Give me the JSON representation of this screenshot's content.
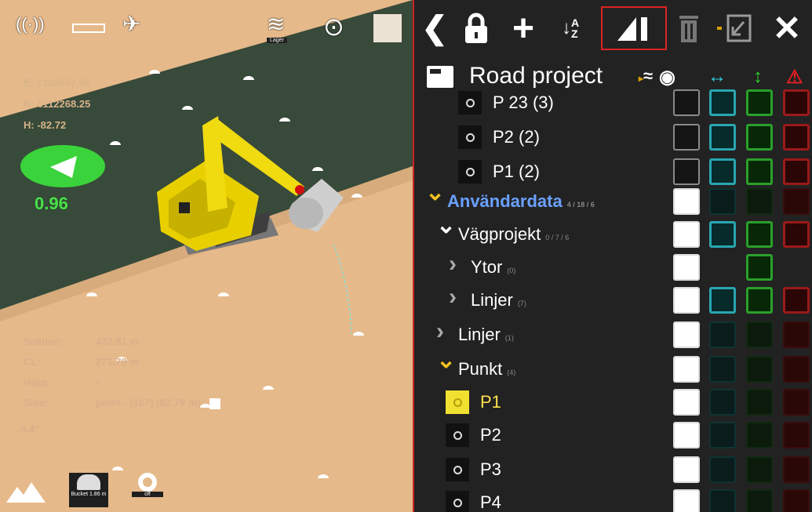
{
  "view": {
    "hud_top": {
      "signal_icon": "radio-signal-icon",
      "battery_icon": "battery-icon",
      "satellite_icon": "satellite-icon",
      "layers_icon": "layers-icon",
      "layers_label": "Lager",
      "locate_icon": "crosshair-icon",
      "cube_icon": "cube-icon"
    },
    "coords": {
      "e": "E: 1336957.66",
      "n": "N: 6112268.25",
      "h": "H: -82.72"
    },
    "speed": "0.96",
    "info": [
      {
        "key": "Sektion:",
        "value": "433.81 m"
      },
      {
        "key": "CL:",
        "value": "271.78 m"
      },
      {
        "key": "Höjd:",
        "value": "-"
      },
      {
        "key": "Sida:",
        "value": "point - (167) (82.79 m)"
      }
    ],
    "angle": "-8.4°",
    "bottom_tools": [
      {
        "icon": "terrain-icon",
        "label": ""
      },
      {
        "icon": "bucket-icon",
        "label": "Bucket 1.86 m"
      },
      {
        "icon": "target-icon",
        "label": "off"
      }
    ]
  },
  "panel": {
    "toolbar": [
      {
        "name": "back-button",
        "glyph": "❮"
      },
      {
        "name": "lock-button",
        "glyph": "🔒"
      },
      {
        "name": "add-button",
        "glyph": "+"
      },
      {
        "name": "sort-az-button",
        "glyph": "↓A Z"
      },
      {
        "name": "measure-button",
        "glyph": "◢Ⅰ"
      },
      {
        "name": "delete-button",
        "glyph": "🗑"
      },
      {
        "name": "import-button",
        "glyph": "⇲"
      },
      {
        "name": "close-button",
        "glyph": "✕"
      }
    ],
    "project_title": "Road project",
    "tree": [
      {
        "level": 2,
        "type": "point",
        "label": "P 23 (3)",
        "count": "",
        "vis": "off",
        "h": "on",
        "v": "on",
        "w": "on"
      },
      {
        "level": 2,
        "type": "point",
        "label": "P2 (2)",
        "count": "",
        "vis": "off",
        "h": "on",
        "v": "on",
        "w": "on"
      },
      {
        "level": 2,
        "type": "point",
        "label": "P1 (2)",
        "count": "",
        "vis": "off",
        "h": "on",
        "v": "on",
        "w": "on"
      },
      {
        "level": 0,
        "type": "group",
        "expanded": true,
        "label": "Användardata",
        "count": "4 / 18 / 6",
        "color": "blue",
        "vis": "on",
        "h": "off",
        "v": "off",
        "w": "off"
      },
      {
        "level": 1,
        "type": "group",
        "expanded": true,
        "label": "Vägprojekt",
        "count": "0 / 7 / 6",
        "vis": "on",
        "h": "on",
        "v": "on",
        "w": "on"
      },
      {
        "level": 2,
        "type": "group",
        "expanded": false,
        "label": "Ytor",
        "count": "(0)",
        "vis": "on",
        "h": "none",
        "v": "on",
        "w": "none"
      },
      {
        "level": 2,
        "type": "group",
        "expanded": false,
        "label": "Linjer",
        "count": "(7)",
        "vis": "on",
        "h": "on",
        "v": "on",
        "w": "on"
      },
      {
        "level": 1,
        "type": "group",
        "expanded": false,
        "label": "Linjer",
        "count": "(1)",
        "vis": "on",
        "h": "off",
        "v": "off",
        "w": "off"
      },
      {
        "level": 1,
        "type": "group",
        "expanded": true,
        "label": "Punkt",
        "count": "(4)",
        "color": "white",
        "vis": "on",
        "h": "off",
        "v": "off",
        "w": "off"
      },
      {
        "level": 1,
        "type": "point",
        "label": "P1",
        "count": "",
        "selected": true,
        "vis": "on",
        "h": "off",
        "v": "off",
        "w": "off"
      },
      {
        "level": 1,
        "type": "point",
        "label": "P2",
        "count": "",
        "vis": "on",
        "h": "off",
        "v": "off",
        "w": "off"
      },
      {
        "level": 1,
        "type": "point",
        "label": "P3",
        "count": "",
        "vis": "on",
        "h": "off",
        "v": "off",
        "w": "off"
      },
      {
        "level": 1,
        "type": "point",
        "label": "P4",
        "count": "",
        "vis": "on",
        "h": "off",
        "v": "off",
        "w": "off"
      }
    ],
    "colors": {
      "accent_blue": "#6aa0ff",
      "selected_yellow": "#ffe14d",
      "horizontal_cyan": "#29a6b0",
      "vertical_green": "#2aa02a",
      "warning_red": "#d22222"
    }
  }
}
